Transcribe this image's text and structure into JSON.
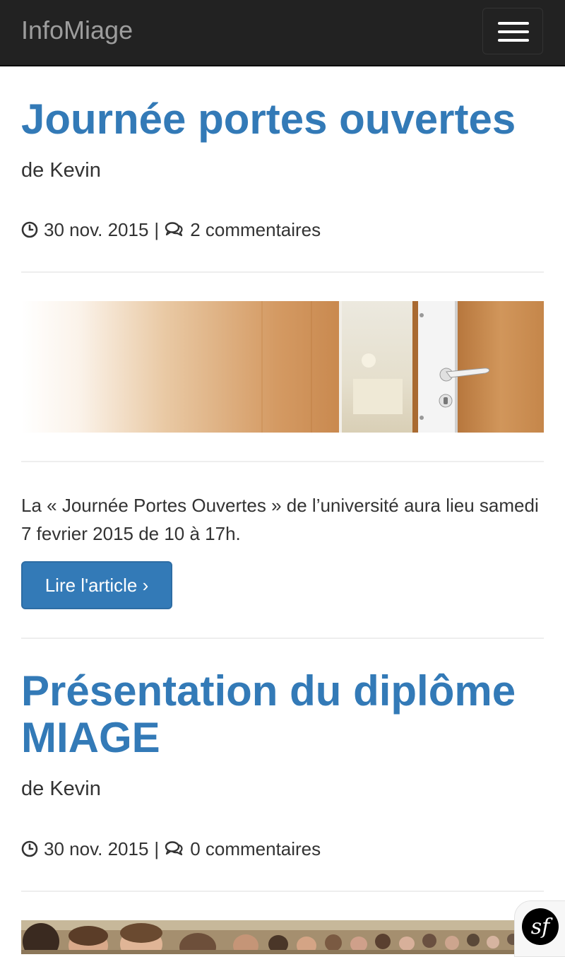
{
  "navbar": {
    "brand": "InfoMiage",
    "toggle_icon": "hamburger-menu-icon"
  },
  "articles": [
    {
      "title": "Journée portes ouvertes",
      "author": "de Kevin",
      "date": "30 nov. 2015",
      "separator": "|",
      "comments": "2 commentaires",
      "excerpt": "La « Journée Portes Ouvertes » de l’université aura lieu samedi 7 fevrier 2015 de 10 à 17h.",
      "read_more": "Lire l'article ›"
    },
    {
      "title": "Présentation du diplôme MIAGE",
      "author": "de Kevin",
      "date": "30 nov. 2015",
      "separator": "|",
      "comments": "0 commentaires"
    }
  ],
  "colors": {
    "link": "#337ab7",
    "navbar_bg": "#222222",
    "brand": "#9d9d9d"
  },
  "debug_toolbar": {
    "icon": "symfony-logo-icon",
    "label": "sf"
  }
}
